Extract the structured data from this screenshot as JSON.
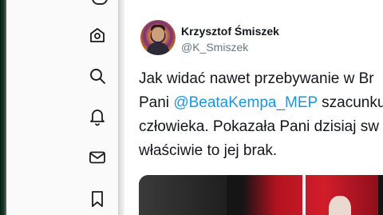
{
  "nav": {
    "items": [
      {
        "icon": "home-icon",
        "label": ""
      },
      {
        "icon": "search-icon",
        "label": ""
      },
      {
        "icon": "bell-icon",
        "label": ""
      },
      {
        "icon": "mail-icon",
        "label": ""
      },
      {
        "icon": "bookmark-icon",
        "label": ""
      }
    ]
  },
  "tweet": {
    "author_name": "Krzysztof Śmiszek",
    "author_handle": "@K_Smiszek",
    "lines": [
      {
        "before": "Jak widać nawet przebywanie w Br",
        "mention": "",
        "after": ""
      },
      {
        "before": "Pani ",
        "mention": "@BeataKempa_MEP",
        "after": " szacunku"
      },
      {
        "before": "człowieka. Pokazała Pani dzisiaj sw",
        "mention": "",
        "after": ""
      },
      {
        "before": "właściwie to jej brak.",
        "mention": "",
        "after": ""
      }
    ]
  },
  "colors": {
    "text": "#14171a",
    "secondary_text": "#657786",
    "mention": "#1b95e0"
  }
}
